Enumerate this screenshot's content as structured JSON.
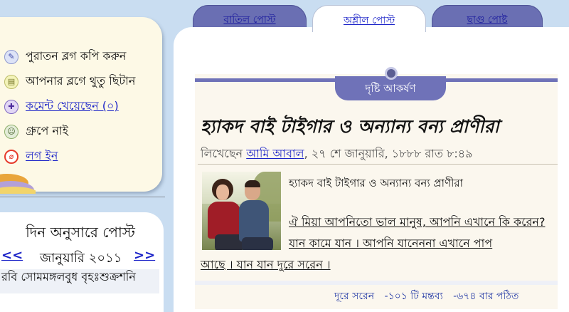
{
  "tabs": [
    {
      "label": "বাতিল পোস্ট",
      "active": false
    },
    {
      "label": "অশ্লীল পোস্ট",
      "active": true
    },
    {
      "label": "ছাগু পোষ্ট",
      "active": false
    }
  ],
  "menu": {
    "items": [
      {
        "label": "পুরাতন ব্লগ কপি করুন",
        "icon": "pencil-icon",
        "link": false
      },
      {
        "label": "আপনার ব্লগে থুতু ছিটান",
        "icon": "note-icon",
        "link": false
      },
      {
        "label": "কমেন্ট খেয়েছেন (০)",
        "icon": "comment-icon",
        "link": true
      },
      {
        "label": "গ্রুপে নাই",
        "icon": "group-icon",
        "link": false
      },
      {
        "label": "লগ ইন",
        "icon": "login-icon",
        "link": true
      }
    ]
  },
  "date_archive": {
    "title": "দিন অনুসারে পোস্ট",
    "prev": "<<",
    "next": ">>",
    "month": "জানুয়ারি ২০১১",
    "weekdays": "রবি সোমমঙ্গলবুধ বৃহঃশুক্রশনি"
  },
  "post": {
    "section_label": "দৃষ্টি আকর্ষণ",
    "title": "হ্যাকদ বাই টাইগার ও অন্যান্য বন্য প্রাণীরা",
    "meta_prefix": "লিখেছেন",
    "author": "আমি আবাল",
    "meta_suffix": ", ২৭ শে জানুয়ারি, ১৮৮৮ রাত ৮:৪৯",
    "subtitle": "হ্যাকদ বাই টাইগার ও অন্যান্য বন্য প্রাণীরা",
    "excerpt_part1": "ঐ মিয়া আপনিতো ভাল মানুষ, আপনি এখানে কি করেন? যান কামে যান । আপনি যানেননা এখানে পাপ",
    "excerpt_part2": "আছে । যান যান দুরে সরেন ।",
    "footer": {
      "action": "দূরে সরেন",
      "comments": "-১০১ টি মন্তব্য",
      "reads": "-৬৭৪ বার পঠিত"
    }
  },
  "colors": {
    "page_bg": "#c9ddf1",
    "accent": "#6f72b8",
    "link": "#1a22c8"
  }
}
